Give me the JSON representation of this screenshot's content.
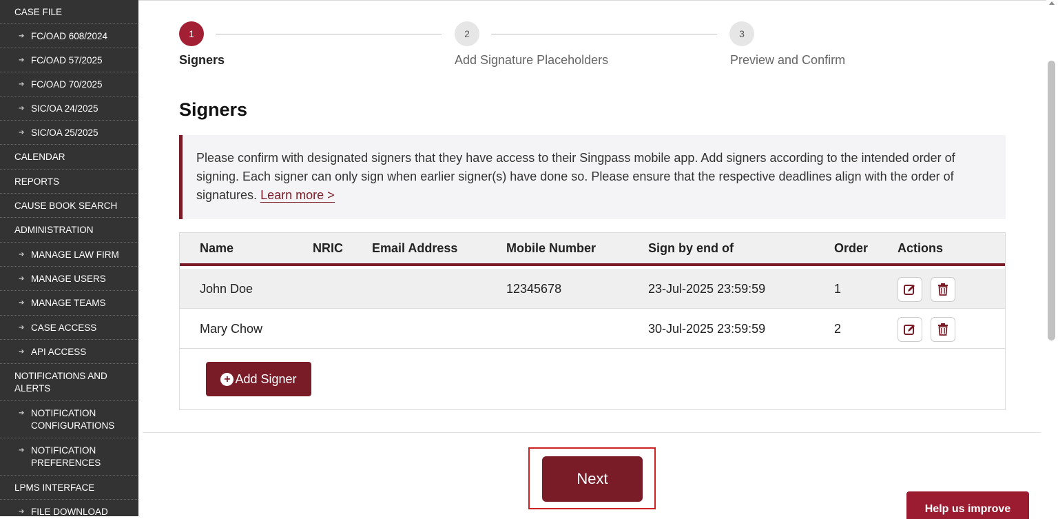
{
  "sidebar": {
    "items": [
      {
        "label": "CASE FILE",
        "sub": false
      },
      {
        "label": "FC/OAD 608/2024",
        "sub": true
      },
      {
        "label": "FC/OAD 57/2025",
        "sub": true
      },
      {
        "label": "FC/OAD 70/2025",
        "sub": true
      },
      {
        "label": "SIC/OA 24/2025",
        "sub": true
      },
      {
        "label": "SIC/OA 25/2025",
        "sub": true
      },
      {
        "label": "CALENDAR",
        "sub": false
      },
      {
        "label": "REPORTS",
        "sub": false
      },
      {
        "label": "CAUSE BOOK SEARCH",
        "sub": false
      },
      {
        "label": "ADMINISTRATION",
        "sub": false
      },
      {
        "label": "MANAGE LAW FIRM",
        "sub": true
      },
      {
        "label": "MANAGE USERS",
        "sub": true
      },
      {
        "label": "MANAGE TEAMS",
        "sub": true
      },
      {
        "label": "CASE ACCESS",
        "sub": true
      },
      {
        "label": "API ACCESS",
        "sub": true
      },
      {
        "label": "NOTIFICATIONS AND ALERTS",
        "sub": false
      },
      {
        "label": "NOTIFICATION CONFIGURATIONS",
        "sub": true
      },
      {
        "label": "NOTIFICATION PREFERENCES",
        "sub": true
      },
      {
        "label": "LPMS INTERFACE",
        "sub": false
      },
      {
        "label": "FILE DOWNLOAD",
        "sub": true
      }
    ]
  },
  "stepper": {
    "steps": [
      {
        "number": "1",
        "label": "Signers",
        "active": true
      },
      {
        "number": "2",
        "label": "Add Signature Placeholders",
        "active": false
      },
      {
        "number": "3",
        "label": "Preview and Confirm",
        "active": false
      }
    ]
  },
  "section": {
    "title": "Signers",
    "notice_text": "Please confirm with designated signers that they have access to their Singpass mobile app. Add signers according to the intended order of signing. Each signer can only sign when earlier signer(s) have done so. Please ensure that the respective deadlines align with the order of signatures.",
    "learn_more": "Learn more >"
  },
  "table": {
    "columns": [
      "Name",
      "NRIC",
      "Email Address",
      "Mobile Number",
      "Sign by end of",
      "Order",
      "Actions"
    ],
    "rows": [
      {
        "name": "John Doe",
        "nric": "",
        "email": "",
        "mobile": "12345678",
        "sign_by": "23-Jul-2025 23:59:59",
        "order": "1"
      },
      {
        "name": "Mary Chow",
        "nric": "",
        "email": "",
        "mobile": "",
        "sign_by": "30-Jul-2025 23:59:59",
        "order": "2"
      }
    ]
  },
  "buttons": {
    "add_signer": "Add Signer",
    "next": "Next",
    "help": "Help us improve"
  },
  "colors": {
    "brand": "#7a1c28",
    "active_step": "#a31f34",
    "sidebar_bg": "#333333"
  }
}
